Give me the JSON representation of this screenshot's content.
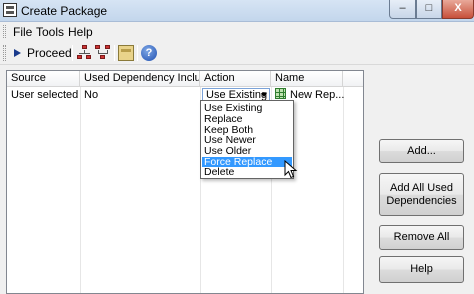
{
  "window": {
    "title": "Create Package"
  },
  "controls": {
    "minimize": "–",
    "maximize": "□",
    "close": "X"
  },
  "menu": {
    "file": "File",
    "tools": "Tools",
    "help": "Help"
  },
  "toolbar": {
    "proceed_label": "Proceed",
    "help_glyph": "?"
  },
  "table": {
    "columns": [
      "Source",
      "Used Dependency Included",
      "Action",
      "Name"
    ],
    "rows": [
      {
        "source": "User selected",
        "used": "No",
        "action": "Use Existing",
        "name": "New Rep..."
      }
    ]
  },
  "action_dropdown": {
    "options": [
      "Use Existing",
      "Replace",
      "Keep Both",
      "Use Newer",
      "Use Older",
      "Force Replace",
      "Delete"
    ],
    "highlighted": "Force Replace"
  },
  "buttons": {
    "add": "Add...",
    "add_all": "Add All Used Dependencies",
    "remove_all": "Remove All",
    "help": "Help"
  },
  "colors": {
    "selection": "#3399ff"
  }
}
